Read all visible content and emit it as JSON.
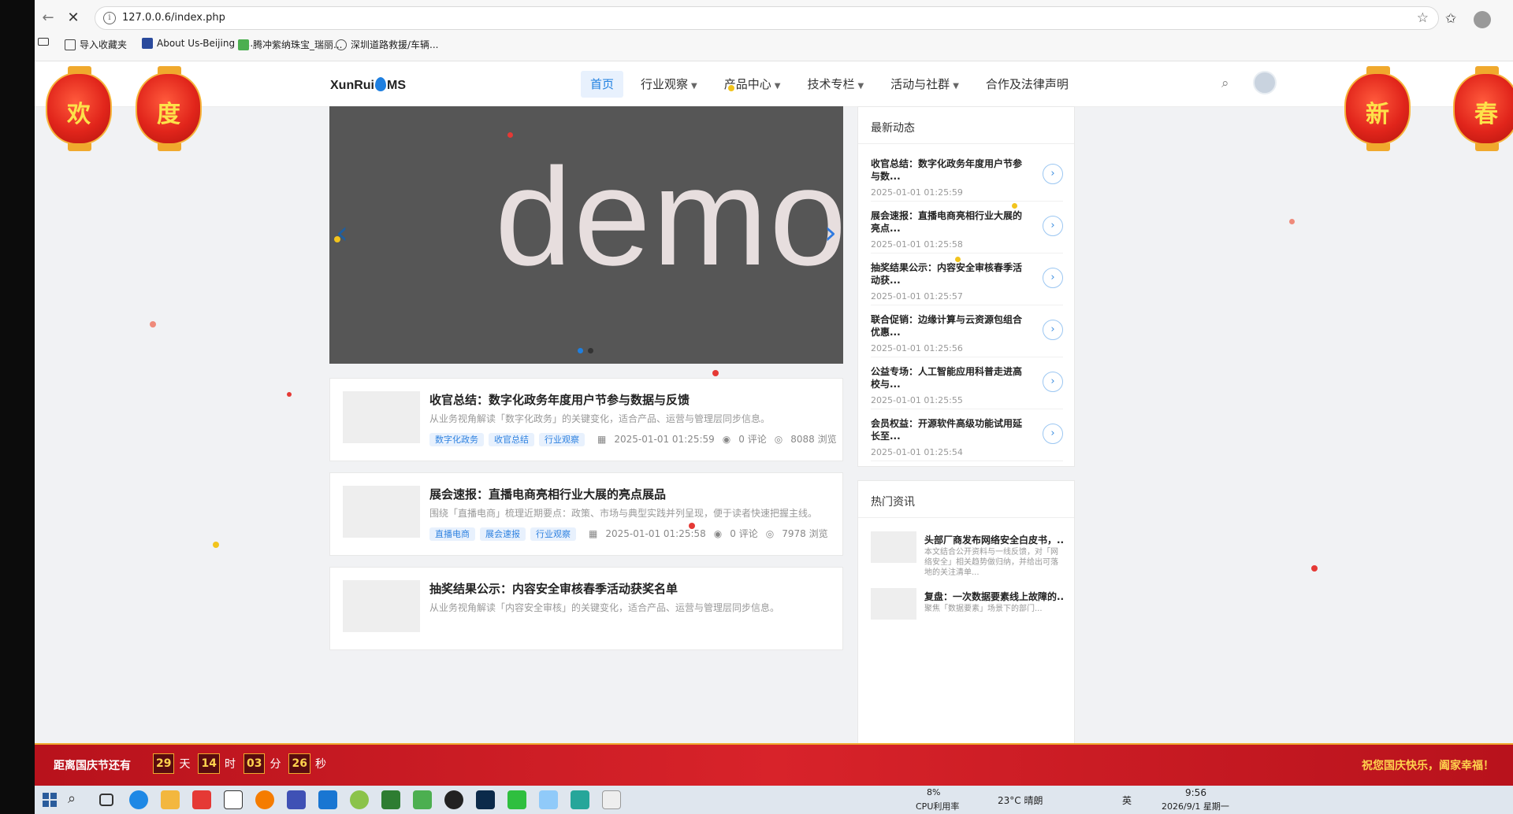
{
  "browser": {
    "url": "127.0.0.6/index.php",
    "bookmarks": [
      "导入收藏夹",
      "About Us-Beijing R...",
      "腾冲紫纳珠宝_瑞丽...",
      "深圳道路救援/车辆..."
    ]
  },
  "site": {
    "logo_left": "XunRui",
    "logo_right": "MS",
    "nav": [
      {
        "label": "首页",
        "active": true,
        "caret": ""
      },
      {
        "label": "行业观察",
        "active": false,
        "caret": "▼"
      },
      {
        "label": "产品中心",
        "active": false,
        "caret": "▼"
      },
      {
        "label": "技术专栏",
        "active": false,
        "caret": "▼"
      },
      {
        "label": "活动与社群",
        "active": false,
        "caret": "▼"
      },
      {
        "label": "合作及法律声明",
        "active": false,
        "caret": ""
      }
    ]
  },
  "lanterns": [
    "欢",
    "度",
    "新",
    "春"
  ],
  "slider": {
    "text": "demo"
  },
  "articles": [
    {
      "title": "收官总结：数字化政务年度用户节参与数据与反馈",
      "desc": "从业务视角解读「数字化政务」的关键变化，适合产品、运营与管理层同步信息。",
      "tags": [
        "数字化政务",
        "收官总结",
        "行业观察"
      ],
      "date": "2025-01-01 01:25:59",
      "comments": "0 评论",
      "views": "8088 浏览"
    },
    {
      "title": "展会速报：直播电商亮相行业大展的亮点展品",
      "desc": "围绕「直播电商」梳理近期要点：政策、市场与典型实践并列呈现，便于读者快速把握主线。",
      "tags": [
        "直播电商",
        "展会速报",
        "行业观察"
      ],
      "date": "2025-01-01 01:25:58",
      "comments": "0 评论",
      "views": "7978 浏览"
    },
    {
      "title": "抽奖结果公示：内容安全审核春季活动获奖名单",
      "desc": "从业务视角解读「内容安全审核」的关键变化，适合产品、运营与管理层同步信息。",
      "tags": [],
      "date": "",
      "comments": "",
      "views": ""
    }
  ],
  "sidebar": {
    "latest_title": "最新动态",
    "latest": [
      {
        "title": "收官总结：数字化政务年度用户节参与数...",
        "date": "2025-01-01 01:25:59"
      },
      {
        "title": "展会速报：直播电商亮相行业大展的亮点...",
        "date": "2025-01-01 01:25:58"
      },
      {
        "title": "抽奖结果公示：内容安全审核春季活动获...",
        "date": "2025-01-01 01:25:57"
      },
      {
        "title": "联合促销：边缘计算与云资源包组合优惠...",
        "date": "2025-01-01 01:25:56"
      },
      {
        "title": "公益专场：人工智能应用科普走进高校与...",
        "date": "2025-01-01 01:25:55"
      },
      {
        "title": "会员权益：开源软件高级功能试用延长至...",
        "date": "2025-01-01 01:25:54"
      }
    ],
    "hot_title": "热门资讯",
    "hot": [
      {
        "title": "头部厂商发布网络安全白皮书，...",
        "desc": "本文结合公开资料与一线反馈，对「网络安全」相关趋势做归纳，并给出可落地的关注清单..."
      },
      {
        "title": "复盘：一次数据要素线上故障的...",
        "desc": "聚焦「数据要素」场景下的部门... "
      }
    ]
  },
  "countdown": {
    "label": "距离国庆节还有",
    "days": "29",
    "days_unit": "天",
    "hours": "14",
    "hours_unit": "时",
    "minutes": "03",
    "minutes_unit": "分",
    "seconds": "26",
    "seconds_unit": "秒",
    "message": "祝您国庆快乐，阖家幸福！"
  },
  "taskbar": {
    "cpu": "8%",
    "cpu_label": "CPU利用率",
    "weather": "23°C  晴朗",
    "ime": "英",
    "time": "9:56",
    "date": "2026/9/1 星期一"
  },
  "colors": {
    "accent": "#1e7fe0",
    "festive_red": "#d8232a",
    "gold": "#f0a92d"
  }
}
